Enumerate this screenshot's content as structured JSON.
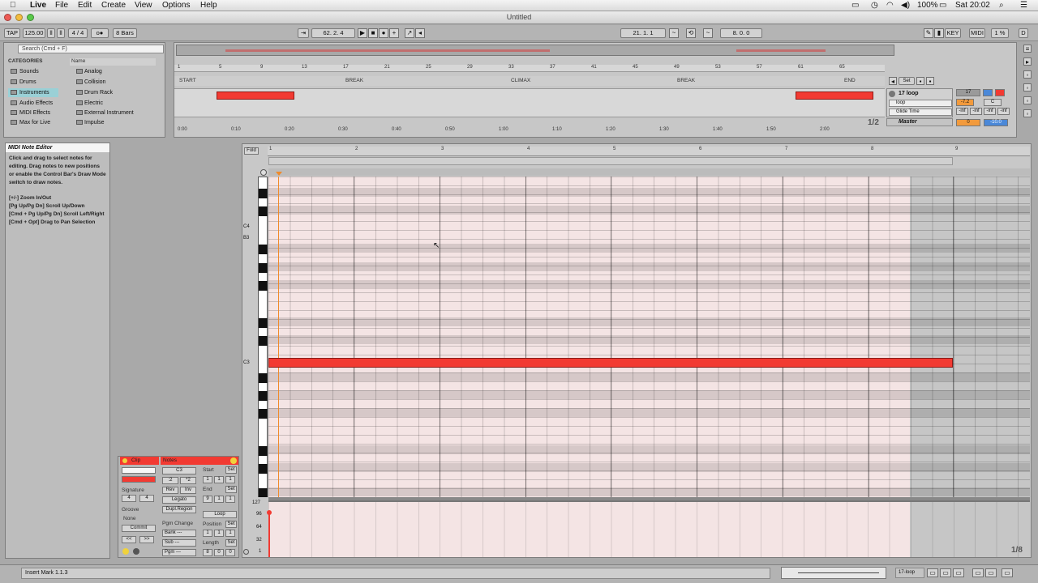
{
  "menubar": {
    "app": "Live",
    "items": [
      "File",
      "Edit",
      "Create",
      "View",
      "Options",
      "Help"
    ],
    "battery": "100%",
    "clock": "Sat 20:02"
  },
  "window": {
    "title": "Untitled"
  },
  "control": {
    "tap": "TAP",
    "tempo": "125.00",
    "sig": "4 / 4",
    "quant": "1 Bar",
    "bars": "8 Bars",
    "pos": "62.  2.  4",
    "loop_start": "21.   1.   1",
    "loop_len": "8.   0.   0",
    "key": "KEY",
    "midi": "MIDI",
    "cpu": "1 %",
    "disk": "D"
  },
  "browser": {
    "search": "Search (Cmd + F)",
    "cat_header": "CATEGORIES",
    "name_header": "Name",
    "categories": [
      "Sounds",
      "Drums",
      "Instruments",
      "Audio Effects",
      "MIDI Effects",
      "Max for Live"
    ],
    "names": [
      "Analog",
      "Collision",
      "Drum Rack",
      "Electric",
      "External Instrument",
      "Impulse"
    ]
  },
  "arrangement": {
    "bars": [
      "1",
      "5",
      "9",
      "13",
      "17",
      "21",
      "25",
      "29",
      "33",
      "37",
      "41",
      "45",
      "49",
      "53",
      "57",
      "61",
      "65"
    ],
    "locators": [
      "START",
      "BREAK",
      "CLIMAX",
      "BREAK",
      "END"
    ],
    "times": [
      "0:00",
      "0:10",
      "0:20",
      "0:30",
      "0:40",
      "0:50",
      "1:00",
      "1:10",
      "1:20",
      "1:30",
      "1:40",
      "1:50",
      "2:00"
    ],
    "page": "1/2"
  },
  "mixer": {
    "set": "Set",
    "track": "17 loop",
    "input": "loop",
    "glide": "Glide Time",
    "master": "Master",
    "vol": "-7.2",
    "pan": "C",
    "inf": "-inf",
    "m_vol": "0",
    "m_pan": "-10.0",
    "track_num": "17"
  },
  "info": {
    "title": "MIDI Note Editor",
    "body": "Click and drag to select notes for editing. Drag notes to new positions or enable the Control Bar's Draw Mode switch to draw notes.",
    "shortcuts": [
      "[+/-] Zoom In/Out",
      "[Pg Up/Pg Dn] Scroll Up/Down",
      "[Cmd + Pg Up/Pg Dn] Scroll Left/Right",
      "[Cmd + Opt] Drag to Pan Selection"
    ]
  },
  "clip": {
    "clip": "Clip",
    "notes": "Notes",
    "signature": "Signature",
    "sig_n": "4",
    "sig_d": "4",
    "groove": "Groove",
    "none": "None",
    "commit": "Commit",
    "note": "C3",
    "half": ":2",
    "dbl": "*2",
    "rev": "Rev",
    "inv": "Inv",
    "legato": "Legato",
    "dupl": "Dupl.Region",
    "pgm": "Pgm Change",
    "bank": "Bank ---",
    "sub": "Sub ---",
    "pgmv": "Pgm ---",
    "start": "Start",
    "end": "End",
    "loop": "Loop",
    "position": "Position",
    "length": "Length",
    "set": "Set",
    "one": "1",
    "eight": "8",
    "nine": "9",
    "zero": "0",
    "prev": "<<",
    "next": ">>"
  },
  "roll": {
    "fold": "Fold",
    "bars": [
      "1",
      "2",
      "3",
      "4",
      "5",
      "6",
      "7",
      "8",
      "9"
    ],
    "c4": "C4",
    "b3": "B3",
    "c3": "C3",
    "page": "1/8",
    "vel": [
      "127",
      "96",
      "64",
      "32",
      "1"
    ]
  },
  "status": {
    "text": "Insert Mark 1.1.3",
    "clip": "17-loop"
  },
  "colors": {
    "red": "#f23a32",
    "accent": "#f0d23c",
    "select": "#9ad0d6"
  }
}
